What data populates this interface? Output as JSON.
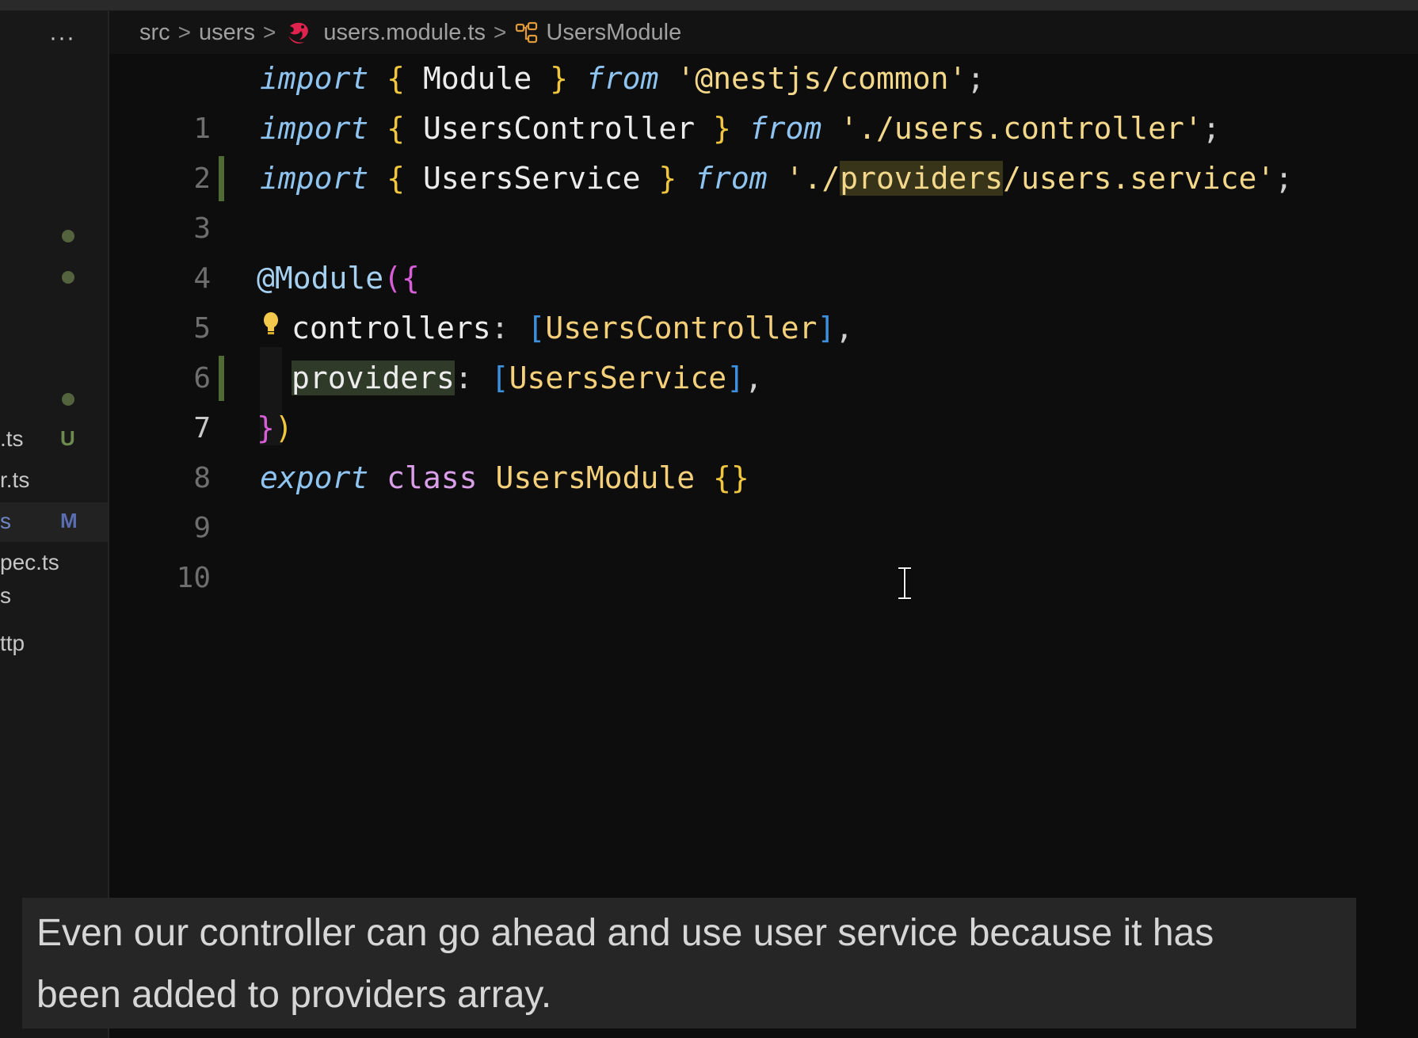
{
  "breadcrumb": {
    "items": [
      "src",
      "users",
      "users.module.ts",
      "UsersModule"
    ],
    "separator": ">"
  },
  "sidebar": {
    "more_label": "···",
    "files": [
      {
        "name": ".ts",
        "status": "U"
      },
      {
        "name": "r.ts",
        "status": ""
      },
      {
        "name": "s",
        "status": "M",
        "selected": true
      },
      {
        "name": "pec.ts",
        "status": ""
      },
      {
        "name": "s",
        "status": ""
      },
      {
        "name": "ttp",
        "status": ""
      }
    ]
  },
  "editor": {
    "active_line": 7,
    "line_numbers": [
      "1",
      "2",
      "3",
      "4",
      "5",
      "6",
      "7",
      "8",
      "9",
      "10"
    ],
    "line1": {
      "kw": "import",
      "open": "{",
      "name": "Module",
      "close": "}",
      "from": "from",
      "path": "'@nestjs/common'",
      "semi": ";"
    },
    "line2": {
      "kw": "import",
      "open": "{",
      "name": "UsersController",
      "close": "}",
      "from": "from",
      "path": "'./users.controller'",
      "semi": ";"
    },
    "line3": {
      "kw": "import",
      "open": "{",
      "name": "UsersService",
      "close": "}",
      "from": "from",
      "path_start": "'./",
      "path_highlight": "providers",
      "path_end": "/users.service'",
      "semi": ";"
    },
    "line5": {
      "decorator": "@Module",
      "paren": "(",
      "brace": "{"
    },
    "line6": {
      "key": "controllers",
      "colon": ":",
      "open": "[",
      "value": "UsersController",
      "close": "]",
      "comma": ","
    },
    "line7": {
      "key": "providers",
      "colon": ":",
      "open": "[",
      "value": "UsersService",
      "close": "]",
      "comma": ","
    },
    "line8": {
      "brace": "}",
      "paren": ")"
    },
    "line9": {
      "export": "export",
      "class": "class",
      "name": "UsersModule",
      "body": "{}"
    }
  },
  "caption": {
    "line1": "Even our controller can go ahead and use user service because it has",
    "line2": "been added to providers array."
  },
  "colors": {
    "background": "#0d0d0d",
    "keyword": "#8fc4f0",
    "string": "#f3d78a",
    "brace": "#f0c63f",
    "bracket": "#3e8fdc",
    "gutter_modified": "#4f6a33"
  },
  "icons": [
    "more-icon",
    "nestjs-icon",
    "module-symbol-icon",
    "lightbulb-icon",
    "text-cursor-icon"
  ]
}
